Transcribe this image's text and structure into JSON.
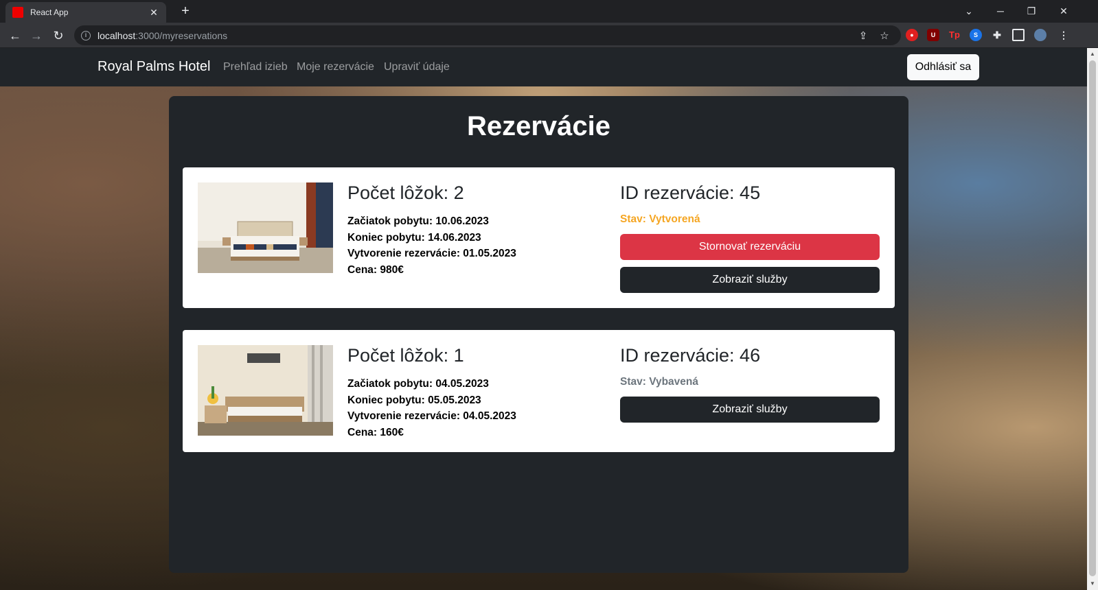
{
  "browser": {
    "tab_title": "React App",
    "url_host": "localhost",
    "url_path": ":3000/myreservations"
  },
  "navbar": {
    "brand": "Royal Palms Hotel",
    "links": [
      "Prehľad izieb",
      "Moje rezervácie",
      "Upraviť údaje"
    ],
    "logout": "Odhlásiť sa"
  },
  "page": {
    "title": "Rezervácie"
  },
  "reservations": [
    {
      "beds": "Počet lôžok: 2",
      "start": "Začiatok pobytu: 10.06.2023",
      "end": "Koniec pobytu: 14.06.2023",
      "created": "Vytvorenie rezervácie: 01.05.2023",
      "price": "Cena: 980€",
      "id": "ID rezervácie: 45",
      "status": "Stav: Vytvorená",
      "status_color": "#f5a623",
      "cancel_label": "Stornovať rezerváciu",
      "services_label": "Zobraziť služby"
    },
    {
      "beds": "Počet lôžok: 1",
      "start": "Začiatok pobytu: 04.05.2023",
      "end": "Koniec pobytu: 05.05.2023",
      "created": "Vytvorenie rezervácie: 04.05.2023",
      "price": "Cena: 160€",
      "id": "ID rezervácie: 46",
      "status": "Stav: Vybavená",
      "status_color": "#6c757d",
      "services_label": "Zobraziť služby"
    }
  ],
  "colors": {
    "danger": "#dc3545",
    "dark": "#212529"
  }
}
